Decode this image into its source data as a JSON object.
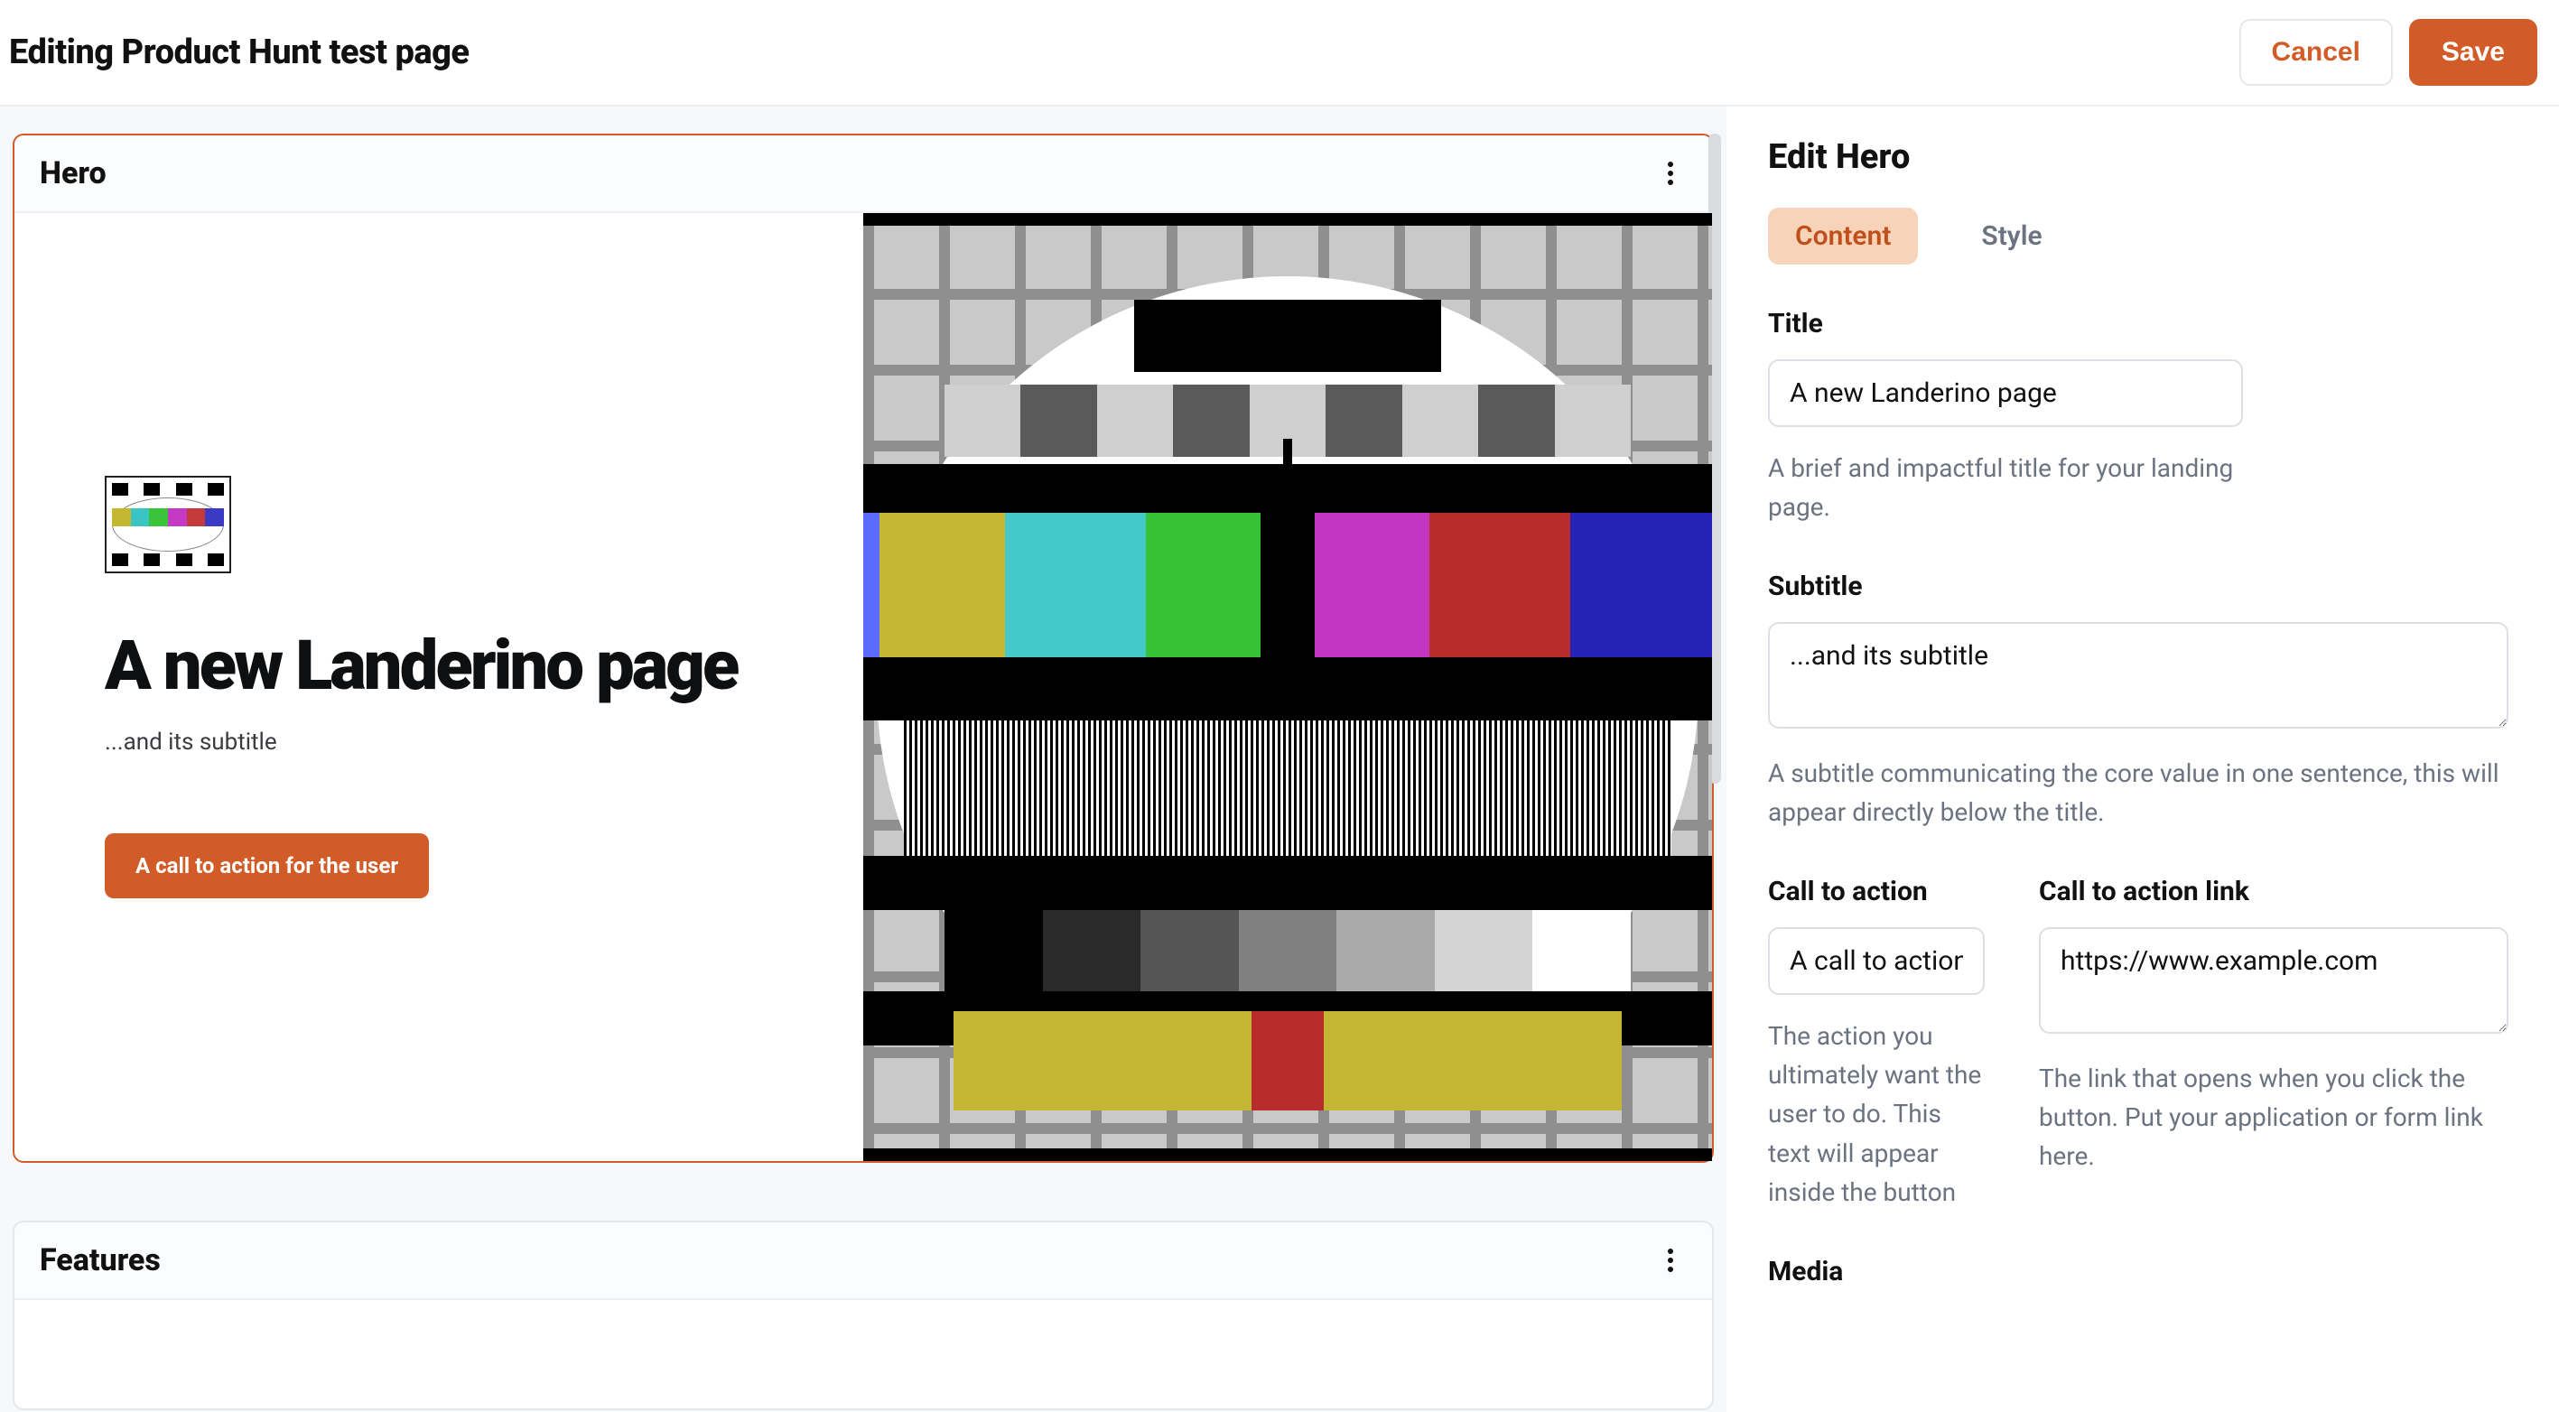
{
  "header": {
    "page_title": "Editing Product Hunt test page",
    "cancel_label": "Cancel",
    "save_label": "Save"
  },
  "canvas": {
    "sections": {
      "hero": {
        "section_name": "Hero",
        "title": "A new Landerino page",
        "subtitle": "...and its subtitle",
        "cta_label": "A call to action for the user"
      },
      "features": {
        "section_name": "Features"
      }
    }
  },
  "sidebar": {
    "heading": "Edit Hero",
    "tabs": {
      "content": "Content",
      "style": "Style"
    },
    "title_field": {
      "label": "Title",
      "value": "A new Landerino page",
      "help": "A brief and impactful title for your landing page."
    },
    "subtitle_field": {
      "label": "Subtitle",
      "value": "...and its subtitle",
      "help": "A subtitle communicating the core value in one sentence, this will appear directly below the title."
    },
    "cta_field": {
      "label": "Call to action",
      "value": "A call to action",
      "help": "The action you ultimately want the user to do. This text will appear inside the button"
    },
    "cta_link_field": {
      "label": "Call to action link",
      "value": "https://www.example.com",
      "help": "The link that opens when you click the button. Put your application or form link here."
    },
    "media_field": {
      "label": "Media"
    }
  },
  "colors": {
    "accent": "#d25c28",
    "accent_soft": "#f7d4b9",
    "border": "#e5e7eb",
    "muted_text": "#6b7280",
    "canvas_bg": "#f7f8fa"
  }
}
